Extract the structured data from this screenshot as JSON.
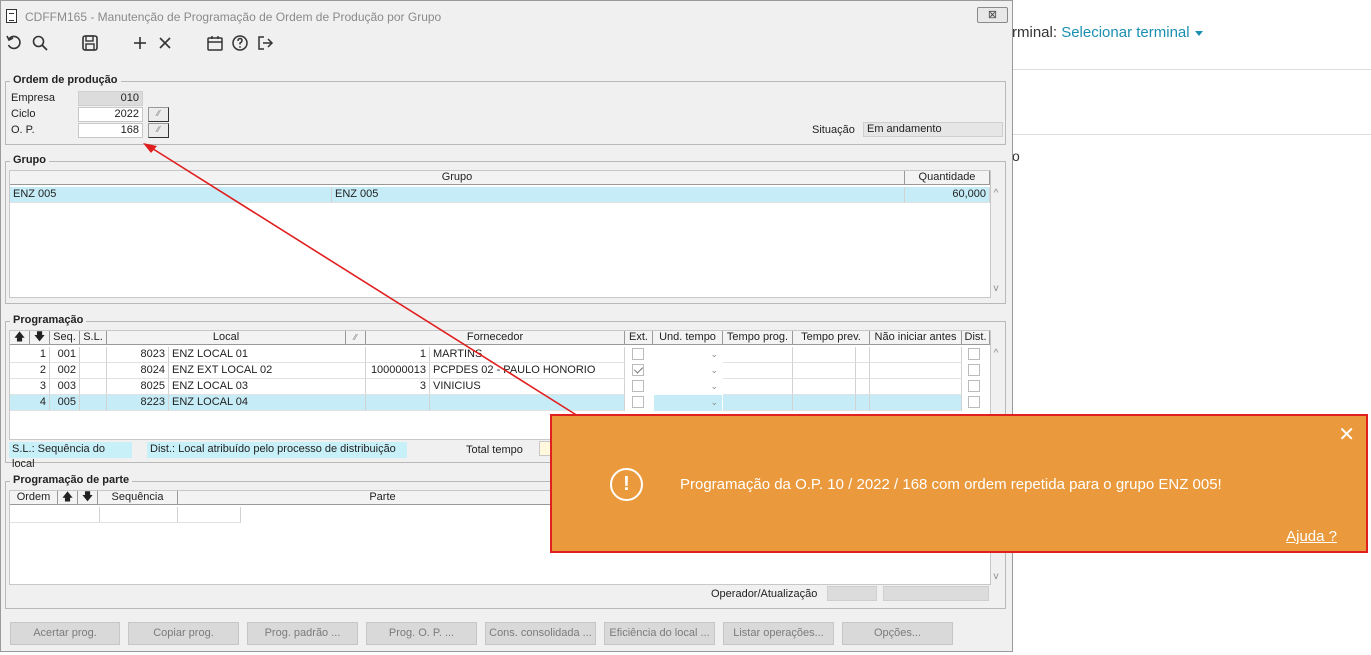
{
  "background": {
    "terminal_label": "rminal:",
    "terminal_link": "Selecionar terminal",
    "partial_text": "o"
  },
  "window": {
    "title": "CDFFM165 - Manutenção de Programação de Ordem de Produção por Grupo",
    "close_symbol": "⊠"
  },
  "toolbar": {
    "icons": [
      "undo-icon",
      "search-icon",
      "save-icon",
      "add-icon",
      "delete-icon",
      "calendar-icon",
      "help-icon",
      "exit-icon"
    ]
  },
  "ordem": {
    "section_label": "Ordem de produção",
    "empresa_label": "Empresa",
    "empresa_value": "010",
    "ciclo_label": "Ciclo",
    "ciclo_value": "2022",
    "op_label": "O. P.",
    "op_value": "168",
    "situacao_label": "Situação",
    "situacao_value": "Em andamento"
  },
  "grupo": {
    "section_label": "Grupo",
    "headers": [
      "Grupo",
      "Quantidade"
    ],
    "rows": [
      {
        "code": "ENZ 005",
        "name": "ENZ 005",
        "quantidade": "60,000"
      }
    ]
  },
  "programacao": {
    "section_label": "Programação",
    "headers": [
      "Seq.",
      "S.L.",
      "Local",
      "Fornecedor",
      "Ext.",
      "Und. tempo",
      "Tempo prog.",
      "Tempo prev.",
      "Não iniciar antes",
      "Dist."
    ],
    "rows": [
      {
        "ordem": "1",
        "seq": "001",
        "sl": "",
        "local_code": "8023",
        "local_name": "ENZ  LOCAL 01",
        "forn_code": "1",
        "forn_name": "MARTINS",
        "ext": false
      },
      {
        "ordem": "2",
        "seq": "002",
        "sl": "",
        "local_code": "8024",
        "local_name": "ENZ EXT LOCAL 02",
        "forn_code": "100000013",
        "forn_name": "PCPDES 02 - PAULO HONORIO",
        "ext": true
      },
      {
        "ordem": "3",
        "seq": "003",
        "sl": "",
        "local_code": "8025",
        "local_name": "ENZ LOCAL 03",
        "forn_code": "3",
        "forn_name": "VINICIUS",
        "ext": false
      },
      {
        "ordem": "4",
        "seq": "005",
        "sl": "",
        "local_code": "8223",
        "local_name": "ENZ LOCAL 04",
        "forn_code": "",
        "forn_name": "",
        "ext": false
      }
    ],
    "legend_sl": "S.L.: Sequência do local",
    "legend_dist": "Dist.: Local atribuído pelo processo de distribuição",
    "total_tempo_label": "Total tempo"
  },
  "parte": {
    "section_label": "Programação de parte",
    "headers": [
      "Ordem",
      "Sequência",
      "Parte"
    ],
    "operador_label": "Operador/Atualização"
  },
  "buttons": [
    {
      "label": "Acertar prog."
    },
    {
      "label": "Copiar prog."
    },
    {
      "label": "Prog. padrão ..."
    },
    {
      "label": "Prog. O. P. ..."
    },
    {
      "label": "Cons. consolidada ..."
    },
    {
      "label": "Eficiência do local ..."
    },
    {
      "label": "Listar operações..."
    },
    {
      "label": "Opções..."
    }
  ],
  "toast": {
    "message": "Programação da O.P. 10 / 2022 / 168 com ordem repetida para o grupo ENZ 005!",
    "help_link": "Ajuda ?",
    "close_symbol": "✕",
    "icon_symbol": "!"
  },
  "colors": {
    "toast_bg": "#ea9a3c",
    "toast_border": "#e01f1f",
    "selection": "#c6ecf7",
    "link": "#1b8fb0"
  }
}
